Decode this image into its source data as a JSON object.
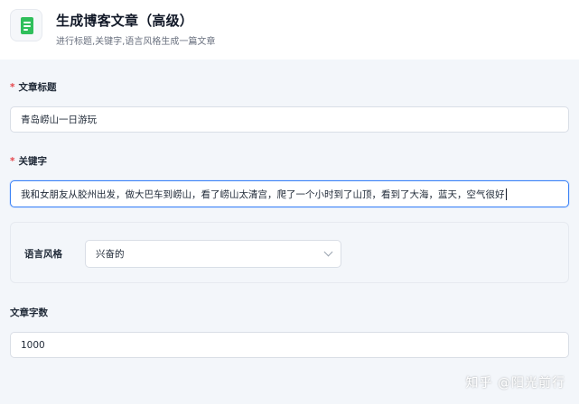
{
  "header": {
    "title": "生成博客文章（高级）",
    "subtitle": "进行标题,关键字,语言风格生成一篇文章",
    "icon": "document-icon"
  },
  "form": {
    "title_field": {
      "required": "*",
      "label": "文章标题",
      "value": "青岛崂山一日游玩"
    },
    "keywords_field": {
      "required": "*",
      "label": "关键字",
      "value": "我和女朋友从胶州出发，做大巴车到崂山，看了崂山太清宫，爬了一个小时到了山顶，看到了大海，蓝天，空气很好"
    },
    "style_field": {
      "label": "语言风格",
      "selected": "兴奋的"
    },
    "word_count_field": {
      "label": "文章字数",
      "value": "1000"
    }
  },
  "watermark": "知乎 @阳光前行",
  "colors": {
    "accent": "#3b82f6",
    "required": "#e5484d",
    "icon_green": "#2fbf5b"
  }
}
